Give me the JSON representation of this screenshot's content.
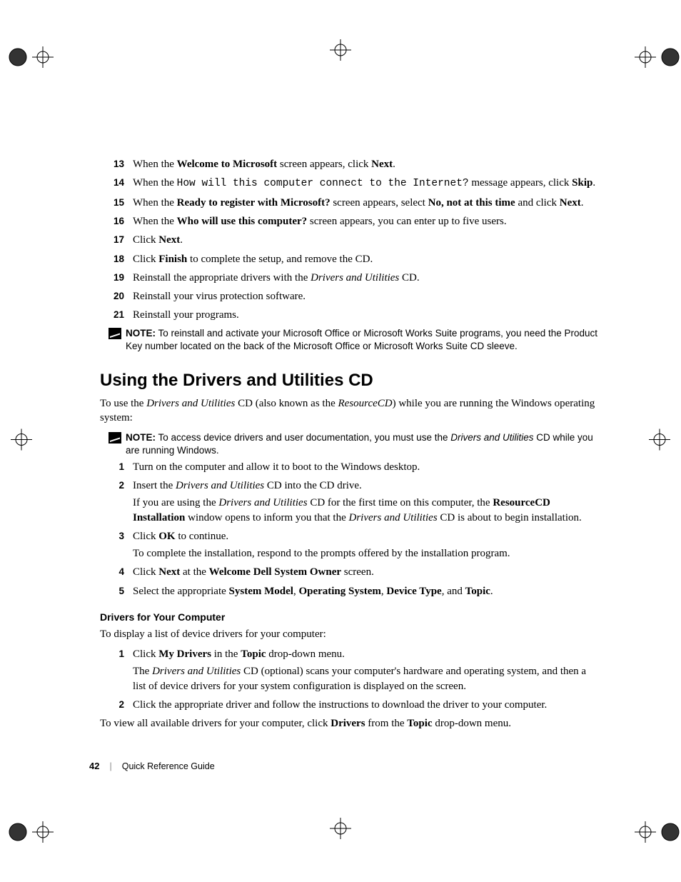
{
  "list1": {
    "items": [
      {
        "n": "13",
        "html": "When the <span class='bold'>Welcome to Microsoft</span> screen appears, click <span class='bold'>Next</span>."
      },
      {
        "n": "14",
        "html": "When the <span class='mono'>How will this computer connect to the Internet?</span> message appears, click <span class='bold'>Skip</span>."
      },
      {
        "n": "15",
        "html": "When the <span class='bold'>Ready to register with Microsoft?</span> screen appears, select <span class='bold'>No, not at this time</span> and click <span class='bold'>Next</span>."
      },
      {
        "n": "16",
        "html": "When the <span class='bold'>Who will use this computer?</span> screen appears, you can enter up to five users."
      },
      {
        "n": "17",
        "html": "Click <span class='bold'>Next</span>."
      },
      {
        "n": "18",
        "html": "Click <span class='bold'>Finish</span> to complete the setup, and remove the CD."
      },
      {
        "n": "19",
        "html": "Reinstall the appropriate drivers with the <span class='italic'>Drivers and Utilities</span> CD."
      },
      {
        "n": "20",
        "html": "Reinstall your virus protection software."
      },
      {
        "n": "21",
        "html": "Reinstall your programs."
      }
    ]
  },
  "note1": {
    "label": "NOTE:",
    "text": " To reinstall and activate your Microsoft Office or Microsoft Works Suite programs, you need the Product Key number located on the back of the Microsoft Office or Microsoft Works Suite CD sleeve."
  },
  "section": {
    "heading": "Using the Drivers and Utilities CD",
    "intro_html": "To use the <span class='italic'>Drivers and Utilities</span> CD (also known as the <span class='italic'>ResourceCD</span>) while you are running the Windows operating system:"
  },
  "note2": {
    "label": "NOTE:",
    "html": " To access device drivers and user documentation, you must use the <span class='italic'>Drivers and Utilities</span> CD while you are running Windows."
  },
  "list2": {
    "items": [
      {
        "n": "1",
        "html": "Turn on the computer and allow it to boot to the Windows desktop."
      },
      {
        "n": "2",
        "html": "Insert the <span class='italic'>Drivers and Utilities</span> CD into the CD drive.",
        "sub_html": "If you are using the <span class='italic'>Drivers and Utilities</span> CD for the first time on this computer, the <span class='bold'>ResourceCD Installation</span> window opens to inform you that the <span class='italic'>Drivers and Utilities</span> CD is about to begin installation."
      },
      {
        "n": "3",
        "html": "Click <span class='bold'>OK</span> to continue.",
        "sub_html": "To complete the installation, respond to the prompts offered by the installation program."
      },
      {
        "n": "4",
        "html": "Click <span class='bold'>Next</span> at the <span class='bold'>Welcome Dell System Owner</span> screen."
      },
      {
        "n": "5",
        "html": "Select the appropriate <span class='bold'>System Model</span>, <span class='bold'>Operating System</span>, <span class='bold'>Device Type</span>, and <span class='bold'>Topic</span>."
      }
    ]
  },
  "sub": {
    "heading": "Drivers for Your Computer",
    "intro": "To display a list of device drivers for your computer:",
    "items": [
      {
        "n": "1",
        "html": "Click <span class='bold'>My Drivers</span> in the <span class='bold'>Topic</span> drop-down menu.",
        "sub_html": "The <span class='italic'>Drivers and Utilities</span> CD (optional) scans your computer's hardware and operating system, and then a list of device drivers for your system configuration is displayed on the screen."
      },
      {
        "n": "2",
        "html": "Click the appropriate driver and follow the instructions to download the driver to your computer."
      }
    ],
    "outro_html": "To view all available drivers for your computer, click <span class='bold'>Drivers</span> from the <span class='bold'>Topic</span> drop-down menu."
  },
  "footer": {
    "page": "42",
    "title": "Quick Reference Guide"
  }
}
